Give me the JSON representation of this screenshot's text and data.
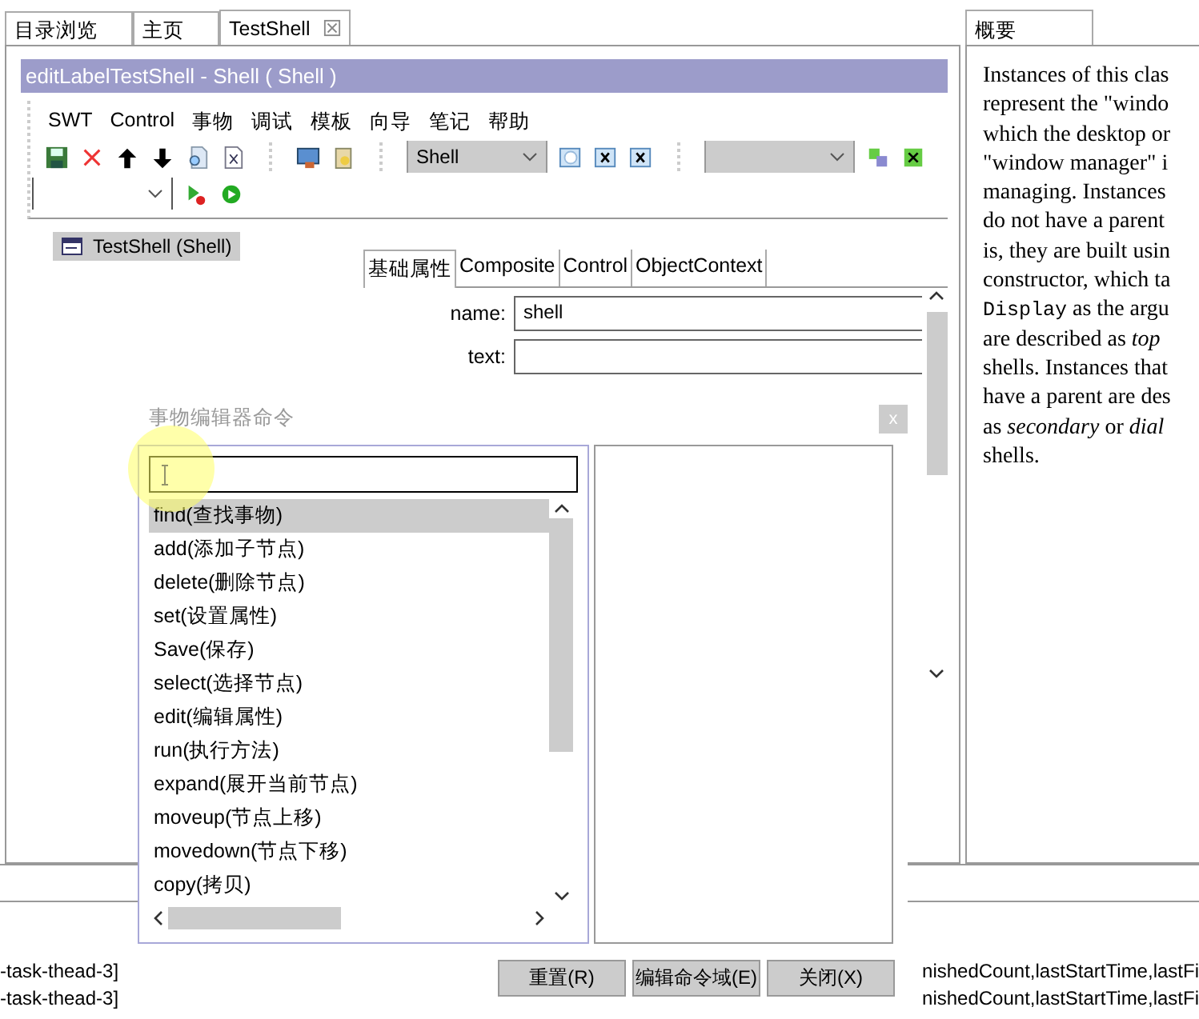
{
  "tabs": [
    {
      "label": "目录浏览",
      "selected": false,
      "closable": false
    },
    {
      "label": "主页",
      "selected": false,
      "closable": false
    },
    {
      "label": "TestShell",
      "selected": true,
      "closable": true
    }
  ],
  "editor": {
    "title": "editLabelTestShell - Shell ( Shell )",
    "menu": [
      "SWT",
      "Control",
      "事物",
      "调试",
      "模板",
      "向导",
      "笔记",
      "帮助"
    ],
    "type_combo": "Shell"
  },
  "tree": [
    {
      "label": "TestShell (Shell)",
      "selected": true
    }
  ],
  "property_tabs": [
    {
      "label": "基础属性",
      "selected": true
    },
    {
      "label": "Composite",
      "selected": false
    },
    {
      "label": "Control",
      "selected": false
    },
    {
      "label": "ObjectContext",
      "selected": false
    }
  ],
  "properties": [
    {
      "label": "name:",
      "value": "shell"
    },
    {
      "label": "text:"
    }
  ],
  "outline": {
    "tab": "概要",
    "lines": [
      {
        "text": "Instances of this clas"
      },
      {
        "text": "represent the \"windo"
      },
      {
        "text": "which the desktop or"
      },
      {
        "text": "\"window manager\" i"
      },
      {
        "text": "managing. Instances"
      },
      {
        "text": "do not have a parent"
      },
      {
        "text": "is, they are built usin"
      },
      {
        "text": "constructor, which ta"
      },
      {
        "code": "Display",
        "text": " as the argu"
      },
      {
        "text": "are described as *top*"
      },
      {
        "text": "shells. Instances that"
      },
      {
        "text": "have a parent are des"
      },
      {
        "text": "as *secondary* or *dial*"
      },
      {
        "text": "shells."
      }
    ]
  },
  "dialog": {
    "title": "事物编辑器命令",
    "close": "x",
    "commands": [
      {
        "label": "find(查找事物)",
        "selected": true
      },
      {
        "label": "add(添加子节点)",
        "selected": false
      },
      {
        "label": "delete(删除节点)",
        "selected": false
      },
      {
        "label": "set(设置属性)",
        "selected": false
      },
      {
        "label": "Save(保存)",
        "selected": false
      },
      {
        "label": "select(选择节点)",
        "selected": false
      },
      {
        "label": "edit(编辑属性)",
        "selected": false
      },
      {
        "label": "run(执行方法)",
        "selected": false
      },
      {
        "label": "expand(展开当前节点)",
        "selected": false
      },
      {
        "label": "moveup(节点上移)",
        "selected": false
      },
      {
        "label": "movedown(节点下移)",
        "selected": false
      },
      {
        "label": "copy(拷贝)",
        "selected": false
      }
    ],
    "buttons": [
      "重置(R)",
      "编辑命令域(E)",
      "关闭(X)"
    ]
  },
  "console": [
    {
      "thread": "-task-thead-3]",
      "tail": "nishedCount,lastStartTime,lastFi"
    },
    {
      "thread": "-task-thead-3]",
      "tail": "nishedCount,lastStartTime,lastFi"
    }
  ]
}
